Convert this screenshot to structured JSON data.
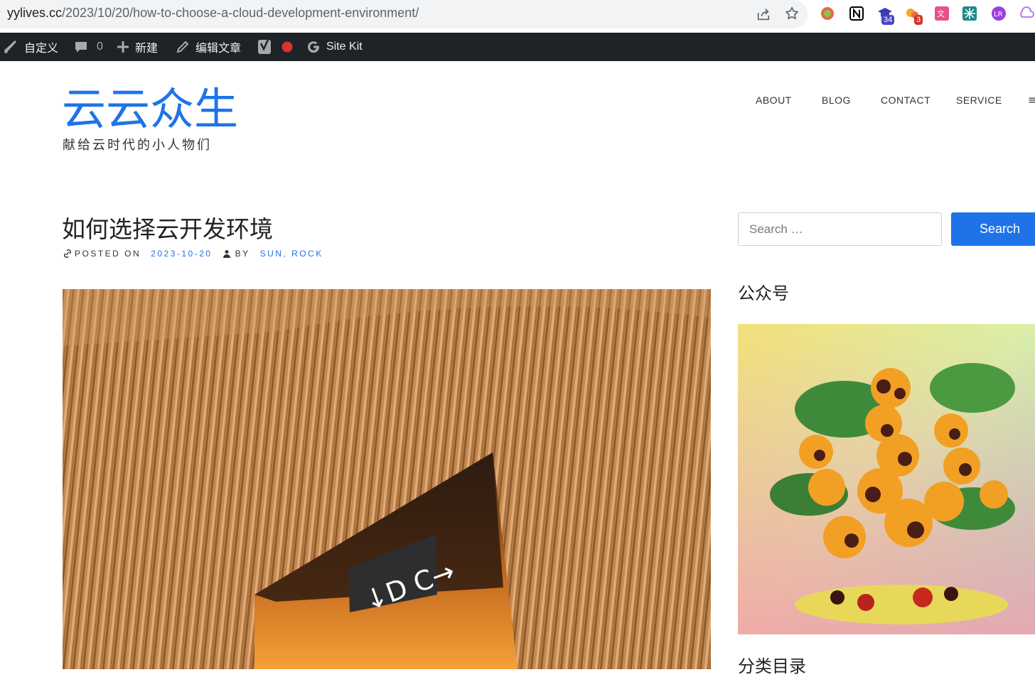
{
  "browser": {
    "url_host": "yylives.cc",
    "url_path": "/2023/10/20/how-to-choose-a-cloud-development-environment/",
    "extensions": [
      {
        "name": "circle-extension-icon",
        "color": "#e8654b"
      },
      {
        "name": "notion-icon",
        "color": "#000000"
      },
      {
        "name": "graduation-cap-icon",
        "color": "#3b3bb3",
        "badge": "34",
        "badge_color": "#4646c8"
      },
      {
        "name": "bubbles-extension-icon",
        "color": "#ef6a4c",
        "badge": "3",
        "badge_color": "#d93025"
      },
      {
        "name": "translate-extension-icon",
        "color": "#e84f8c"
      },
      {
        "name": "network-extension-icon",
        "color": "#1a8a8a"
      },
      {
        "name": "lr-extension-icon",
        "color": "#9b3fe0"
      },
      {
        "name": "cloud-outline-icon",
        "color": "#b56de8"
      }
    ]
  },
  "admin_bar": {
    "customize": "自定义",
    "comments_count": "0",
    "new": "新建",
    "edit_post": "编辑文章",
    "site_kit": "Site Kit"
  },
  "site": {
    "title": "云云众生",
    "description": "献给云时代的小人物们",
    "nav": [
      "ABOUT",
      "BLOG",
      "CONTACT",
      "SERVICE"
    ],
    "nav_more": "≡"
  },
  "post": {
    "title": "如何选择云开发环境",
    "posted_on_label": "POSTED ON",
    "date": "2023-10-20",
    "by_label": "BY",
    "authors": "SUN, ROCK"
  },
  "sidebar": {
    "search_placeholder": "Search …",
    "search_button": "Search",
    "widget1_title": "公众号",
    "widget2_title": "分类目录"
  },
  "colors": {
    "accent": "#1e73e8",
    "admin_bar": "#1d2327"
  }
}
